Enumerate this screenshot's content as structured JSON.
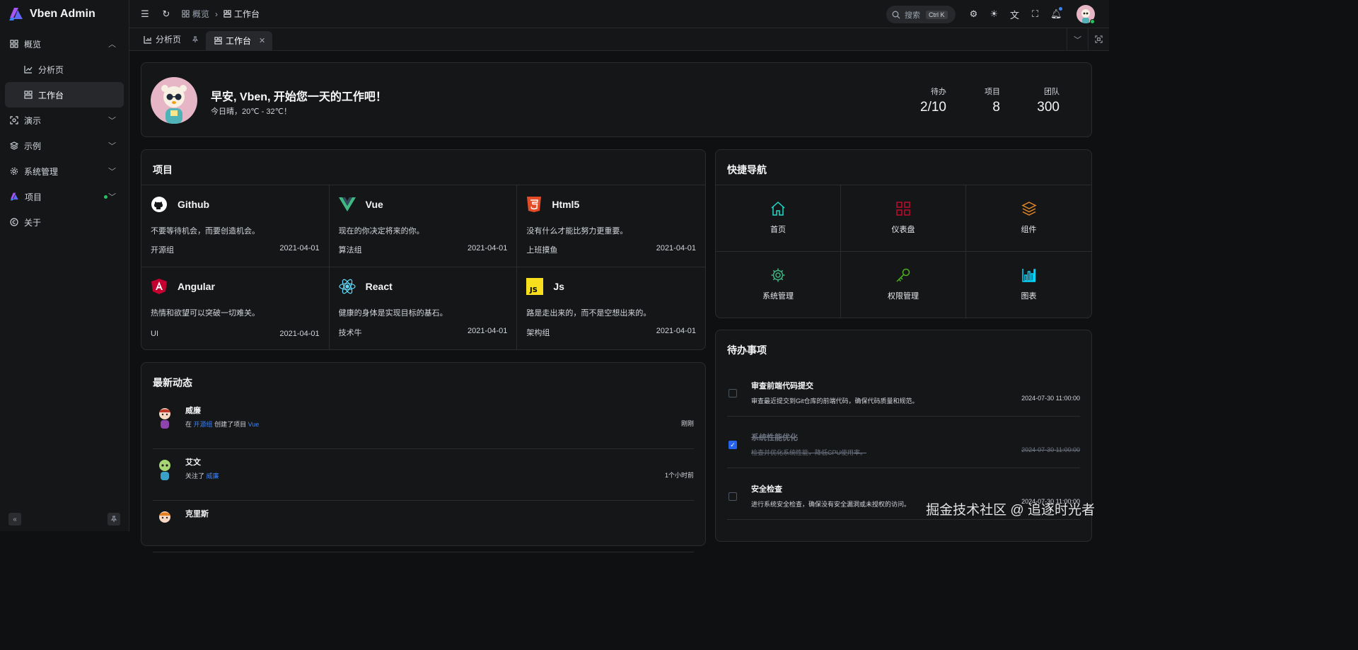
{
  "app": {
    "title": "Vben Admin"
  },
  "sidebar": {
    "items": [
      {
        "label": "概览",
        "icon": "grid-icon",
        "expanded": true
      },
      {
        "label": "分析页",
        "icon": "chart-icon",
        "sub": true
      },
      {
        "label": "工作台",
        "icon": "workspace-icon",
        "sub": true,
        "active": true
      },
      {
        "label": "演示",
        "icon": "demo-icon"
      },
      {
        "label": "示例",
        "icon": "layers-icon"
      },
      {
        "label": "系统管理",
        "icon": "settings-icon"
      },
      {
        "label": "项目",
        "icon": "vben-logo-icon"
      },
      {
        "label": "关于",
        "icon": "copyright-icon"
      }
    ]
  },
  "header": {
    "breadcrumbs": [
      "概览",
      "工作台"
    ],
    "search_placeholder": "搜索",
    "search_shortcut": "Ctrl K"
  },
  "tabs": [
    {
      "label": "分析页",
      "pinned": true
    },
    {
      "label": "工作台",
      "active": true
    }
  ],
  "welcome": {
    "greeting": "早安, Vben, 开始您一天的工作吧！",
    "weather": "今日晴，20℃ - 32℃！",
    "stats": [
      {
        "label": "待办",
        "value": "2/10"
      },
      {
        "label": "项目",
        "value": "8"
      },
      {
        "label": "团队",
        "value": "300"
      }
    ]
  },
  "projects": {
    "title": "项目",
    "items": [
      {
        "name": "Github",
        "desc": "不要等待机会，而要创造机会。",
        "group": "开源组",
        "date": "2021-04-01",
        "icon": "github-icon",
        "color": "#ffffff"
      },
      {
        "name": "Vue",
        "desc": "现在的你决定将来的你。",
        "group": "算法组",
        "date": "2021-04-01",
        "icon": "vue-icon",
        "color": "#3fb984"
      },
      {
        "name": "Html5",
        "desc": "没有什么才能比努力更重要。",
        "group": "上班摸鱼",
        "date": "2021-04-01",
        "icon": "html5-icon",
        "color": "#e34c26"
      },
      {
        "name": "Angular",
        "desc": "热情和欲望可以突破一切难关。",
        "group": "UI",
        "date": "2021-04-01",
        "icon": "angular-icon",
        "color": "#c3002f"
      },
      {
        "name": "React",
        "desc": "健康的身体是实现目标的基石。",
        "group": "技术牛",
        "date": "2021-04-01",
        "icon": "react-icon",
        "color": "#61dafb"
      },
      {
        "name": "Js",
        "desc": "路是走出来的，而不是空想出来的。",
        "group": "架构组",
        "date": "2021-04-01",
        "icon": "js-icon",
        "color": "#f7df1e"
      }
    ]
  },
  "quick_nav": {
    "title": "快捷导航",
    "items": [
      {
        "label": "首页",
        "icon": "home-icon",
        "color": "#1fdaca"
      },
      {
        "label": "仪表盘",
        "icon": "dashboard-icon",
        "color": "#bf0c2c"
      },
      {
        "label": "组件",
        "icon": "layers-icon",
        "color": "#e18525"
      },
      {
        "label": "系统管理",
        "icon": "gear-icon",
        "color": "#3fb27f"
      },
      {
        "label": "权限管理",
        "icon": "key-icon",
        "color": "#4daf1bc9"
      },
      {
        "label": "图表",
        "icon": "bar-chart-icon",
        "color": "#00d8ff"
      }
    ]
  },
  "activity": {
    "title": "最新动态",
    "items": [
      {
        "name": "威廉",
        "pre": "在",
        "link1": "开源组",
        "mid": "创建了项目",
        "link2": "Vue",
        "time": "刚刚"
      },
      {
        "name": "艾文",
        "pre": "关注了",
        "link1": "威廉",
        "mid": "",
        "link2": "",
        "time": "1个小时前"
      },
      {
        "name": "克里斯",
        "pre": "",
        "link1": "",
        "mid": "",
        "link2": "",
        "time": ""
      }
    ]
  },
  "todo": {
    "title": "待办事项",
    "items": [
      {
        "title": "审查前端代码提交",
        "desc": "审查最近提交到Git仓库的前端代码，确保代码质量和规范。",
        "time": "2024-07-30 11:00:00",
        "done": false
      },
      {
        "title": "系统性能优化",
        "desc": "检查并优化系统性能，降低CPU使用率。",
        "time": "2024-07-30 11:00:00",
        "done": true
      },
      {
        "title": "安全检查",
        "desc": "进行系统安全检查，确保没有安全漏洞或未授权的访问。",
        "time": "2024-07-30 11:00:00",
        "done": false
      }
    ]
  },
  "watermark": "掘金技术社区 @ 追逐时光者"
}
